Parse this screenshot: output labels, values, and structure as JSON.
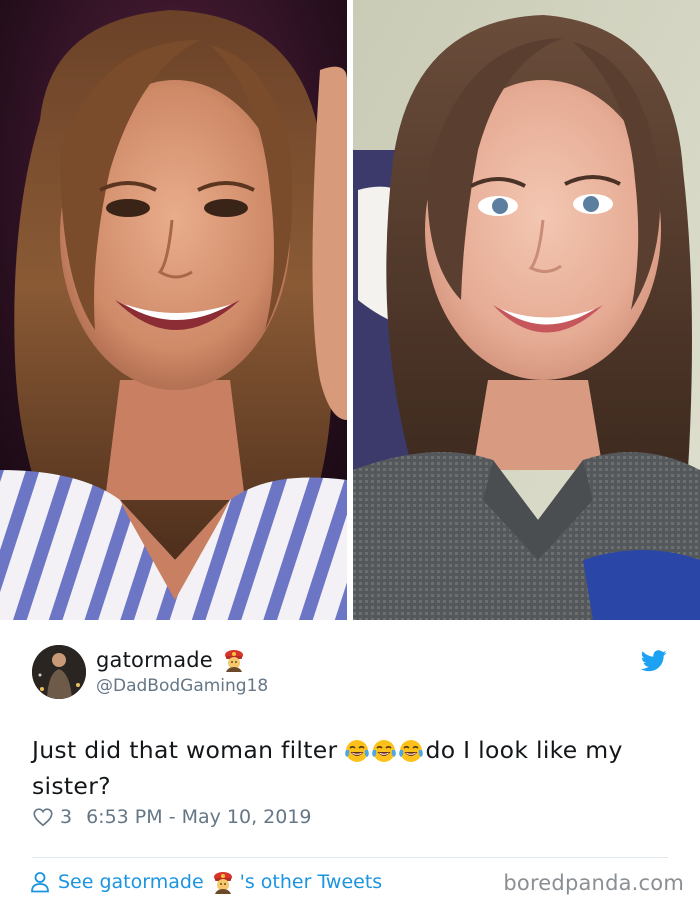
{
  "tweet": {
    "display_name": "gatormade",
    "handle": "@DadBodGaming18",
    "text_before": "Just did that woman filter",
    "text_after": "do I look like my sister?",
    "like_count": "3",
    "timestamp": "6:53 PM - May 10, 2019"
  },
  "footer": {
    "see_prefix": "See gatormade",
    "see_suffix": "'s other Tweets",
    "watermark": "boredpanda.com"
  },
  "icons": {
    "brand": "twitter-bird-icon",
    "like": "heart-icon",
    "profile_link": "person-icon",
    "name_emoji": "firefighter-emoji",
    "text_emoji": "face-with-tears-of-joy-emoji"
  },
  "colors": {
    "link_blue": "#1b95e0",
    "twitter_blue": "#1da1f2",
    "muted_gray": "#657786",
    "text_dark": "#14171a",
    "divider": "#e1e8ed"
  }
}
